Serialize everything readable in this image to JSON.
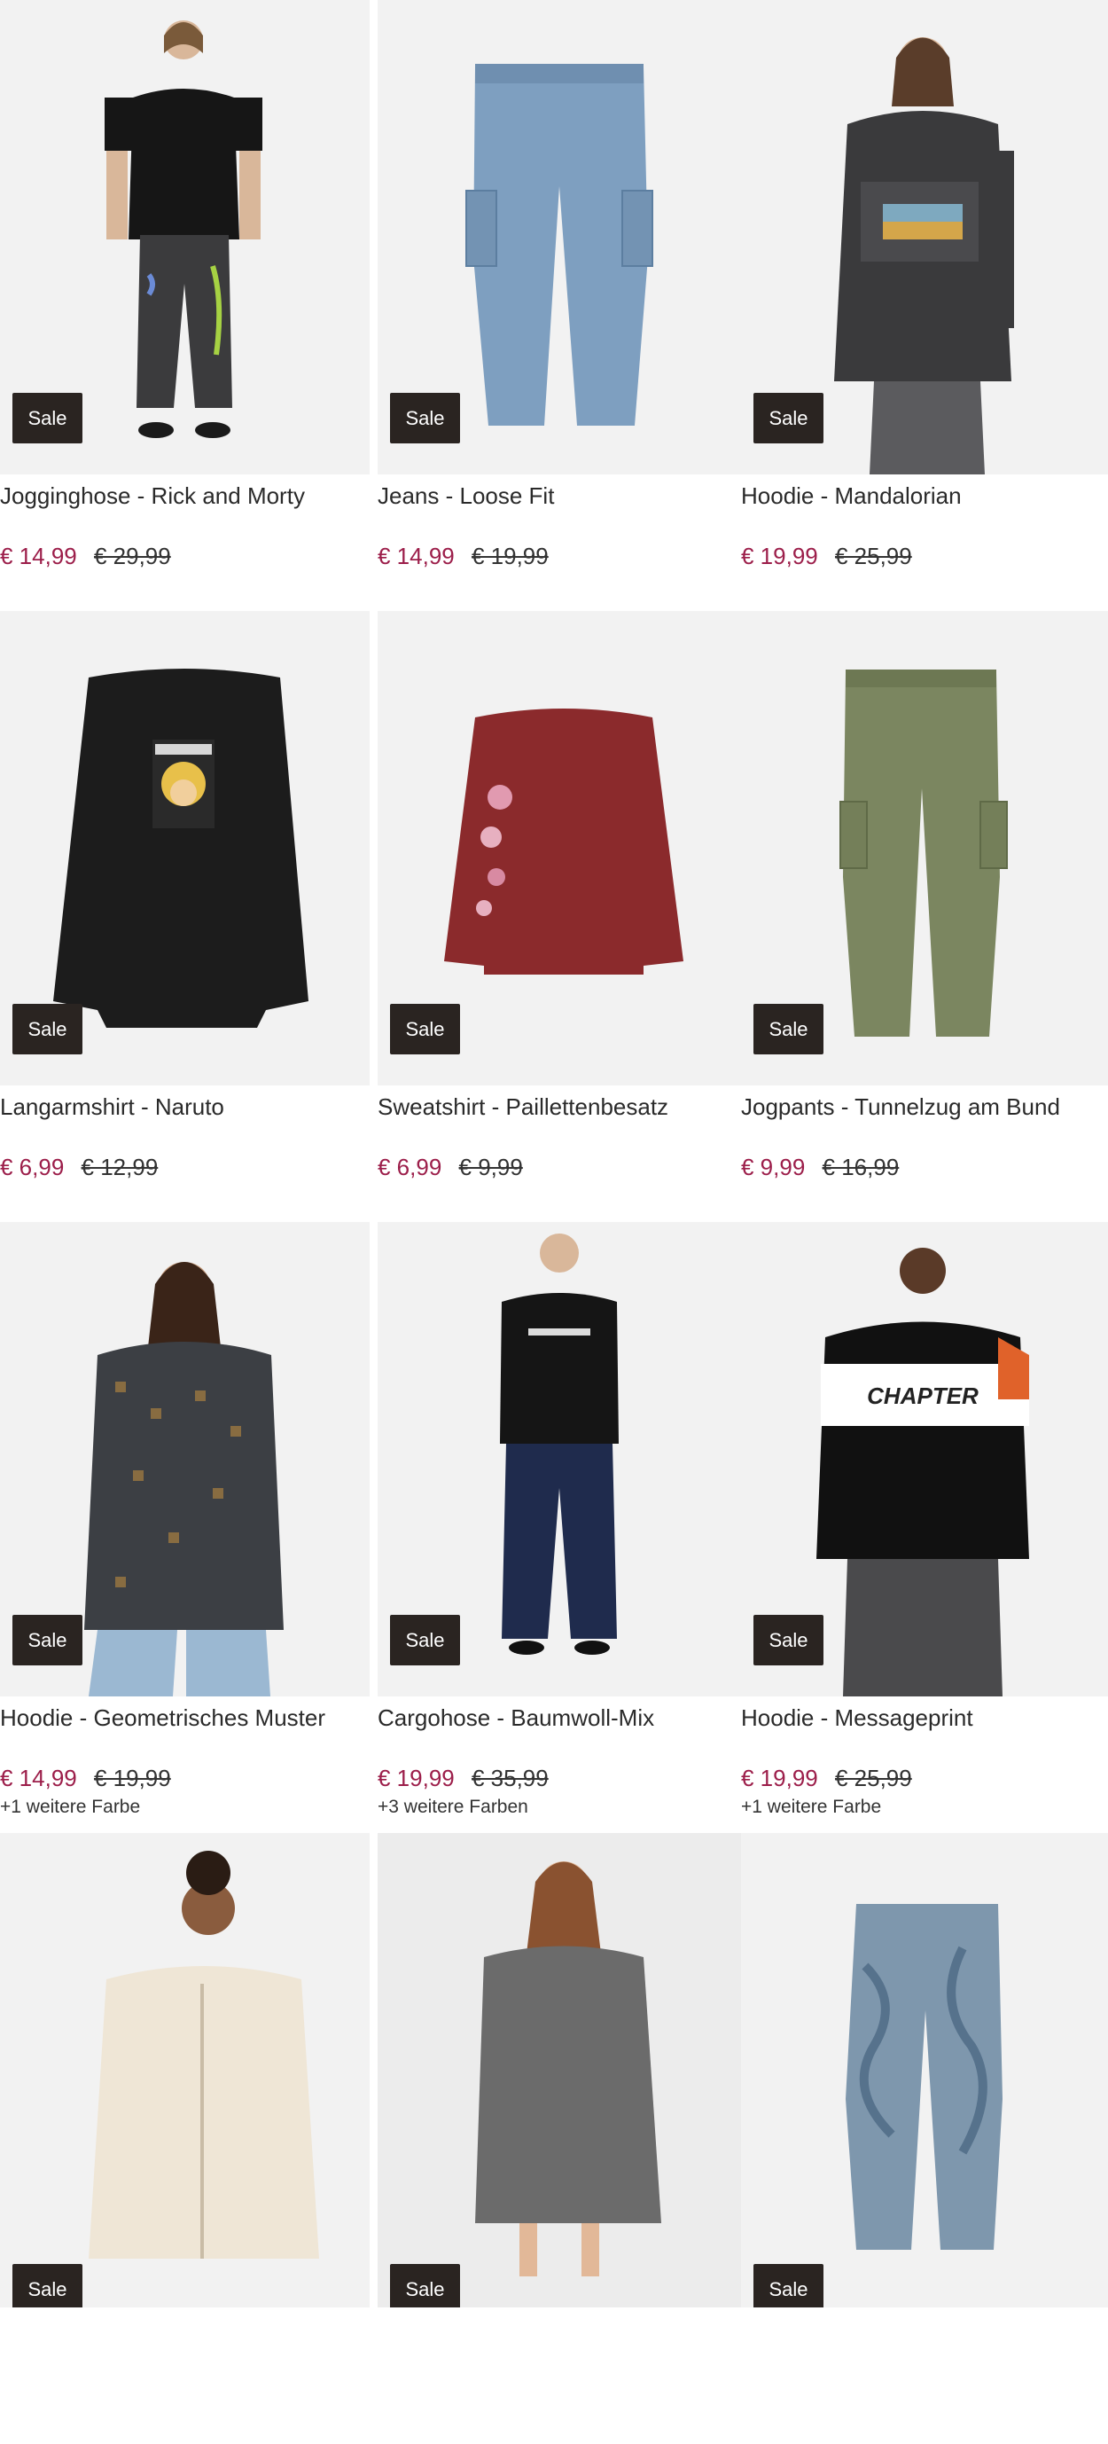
{
  "sale_label": "Sale",
  "colors": {
    "accent_price": "#9c1e4a",
    "badge_bg": "#2a2421",
    "tile_bg": "#f3f3f3"
  },
  "products": [
    {
      "title": "Jogginghose - Rick and Morty",
      "price": "€ 14,99",
      "old_price": "€ 29,99",
      "colors_note": "",
      "image": "man-black-tee-grey-joggers"
    },
    {
      "title": "Jeans - Loose Fit",
      "price": "€ 14,99",
      "old_price": "€ 19,99",
      "colors_note": "",
      "image": "blue-cargo-jeans"
    },
    {
      "title": "Hoodie - Mandalorian",
      "price": "€ 19,99",
      "old_price": "€ 25,99",
      "colors_note": "",
      "image": "man-dark-hoodie-mandalorian"
    },
    {
      "title": "Langarmshirt - Naruto",
      "price": "€ 6,99",
      "old_price": "€ 12,99",
      "colors_note": "",
      "image": "black-longsleeve-naruto"
    },
    {
      "title": "Sweatshirt - Paillettenbesatz",
      "price": "€ 6,99",
      "old_price": "€ 9,99",
      "colors_note": "",
      "image": "red-sweatshirt-flowers"
    },
    {
      "title": "Jogpants - Tunnelzug am Bund",
      "price": "€ 9,99",
      "old_price": "€ 16,99",
      "colors_note": "",
      "image": "olive-cargo-jogpants"
    },
    {
      "title": "Hoodie - Geometrisches Muster",
      "price": "€ 14,99",
      "old_price": "€ 19,99",
      "colors_note": "+1 weitere Farbe",
      "image": "woman-patterned-hoodie"
    },
    {
      "title": "Cargohose - Baumwoll-Mix",
      "price": "€ 19,99",
      "old_price": "€ 35,99",
      "colors_note": "+3 weitere Farben",
      "image": "man-navy-cargo-pants"
    },
    {
      "title": "Hoodie - Messageprint",
      "price": "€ 19,99",
      "old_price": "€ 25,99",
      "colors_note": "+1 weitere Farbe",
      "image": "man-black-hoodie-chapter"
    },
    {
      "title": "",
      "price": "",
      "old_price": "",
      "colors_note": "",
      "image": "woman-cream-zip-hoodie"
    },
    {
      "title": "",
      "price": "",
      "old_price": "",
      "colors_note": "",
      "image": "girl-grey-knit-dress"
    },
    {
      "title": "",
      "price": "",
      "old_price": "",
      "colors_note": "",
      "image": "blue-marble-joggers"
    }
  ]
}
